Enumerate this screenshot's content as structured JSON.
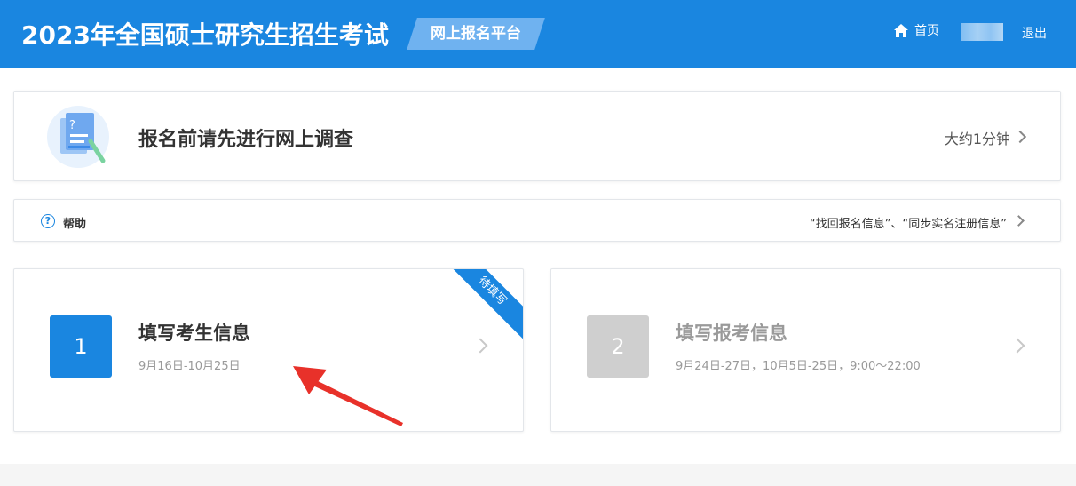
{
  "header": {
    "site_title": "2023年全国硕士研究生招生考试",
    "platform_label": "网上报名平台",
    "home_label": "首页",
    "logout_label": "退出"
  },
  "survey": {
    "title": "报名前请先进行网上调查",
    "time_estimate": "大约1分钟"
  },
  "help": {
    "label": "帮助",
    "icon_glyph": "?",
    "links": "“找回报名信息”、“同步实名注册信息”"
  },
  "steps": [
    {
      "number": "1",
      "title": "填写考生信息",
      "date_range": "9月16日-10月25日",
      "ribbon": "待填写"
    },
    {
      "number": "2",
      "title": "填写报考信息",
      "date_range": "9月24日-27日，10月5日-25日，9:00～22:00"
    }
  ],
  "colors": {
    "primary": "#1a86e0",
    "annotation_arrow": "#e8312a",
    "disabled": "#cfcfcf"
  }
}
